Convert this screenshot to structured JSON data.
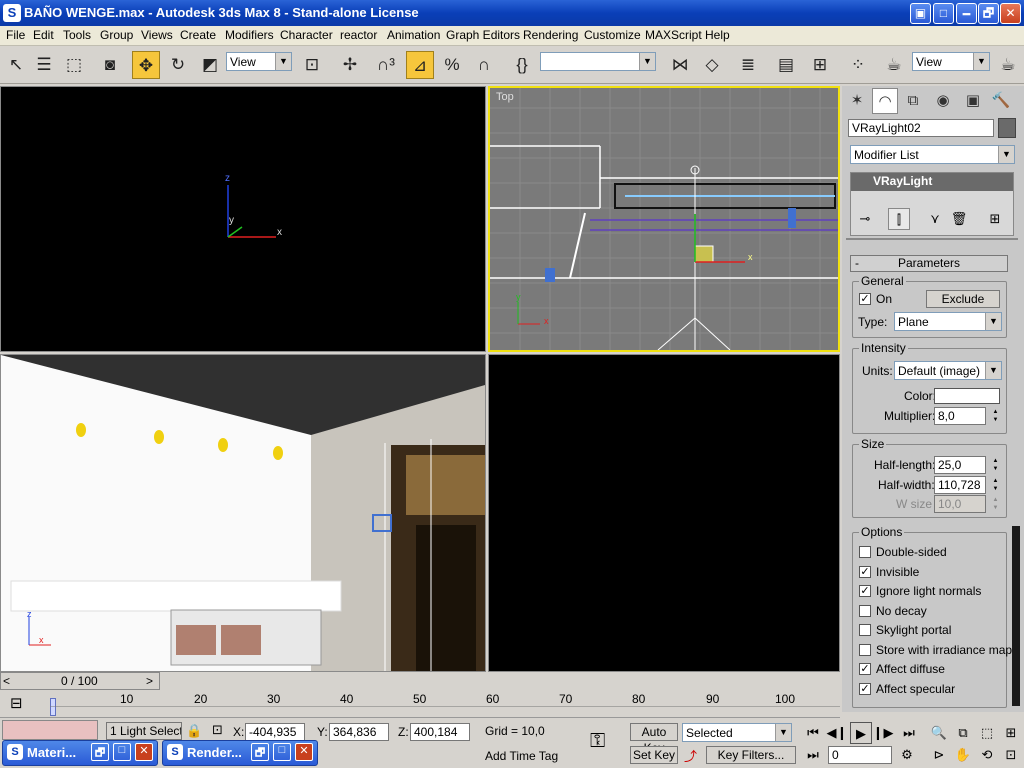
{
  "window": {
    "title": "BAÑO WENGE.max - Autodesk 3ds Max 8  - Stand-alone License",
    "min": "🗕",
    "max": "🗗",
    "close": "✕"
  },
  "menu": [
    "File",
    "Edit",
    "Tools",
    "Group",
    "Views",
    "Create",
    "Modifiers",
    "Character",
    "reactor",
    "Animation",
    "Graph Editors",
    "Rendering",
    "Customize",
    "MAXScript",
    "Help"
  ],
  "toolbar": {
    "ref_coord": "View",
    "named_sel": "",
    "ref_coord2": "View"
  },
  "viewports": {
    "top_label": "Top",
    "axis_x": "x",
    "axis_y": "y",
    "axis_z": "z"
  },
  "panel": {
    "object_name": "VRayLight02",
    "modifier_list": "Modifier List",
    "stack_item": "VRayLight",
    "rollout_title": "Parameters",
    "rollout_sign": "-",
    "general": {
      "title": "General",
      "on_label": "On",
      "on_checked": "✓",
      "exclude": "Exclude",
      "type_label": "Type:",
      "type_value": "Plane"
    },
    "intensity": {
      "title": "Intensity",
      "units_label": "Units:",
      "units_value": "Default (image)",
      "color_label": "Color:",
      "color_value": "#ffffff",
      "multiplier_label": "Multiplier:",
      "multiplier_value": "8,0"
    },
    "size": {
      "title": "Size",
      "half_length_label": "Half-length:",
      "half_length_value": "25,0",
      "half_width_label": "Half-width:",
      "half_width_value": "110,728",
      "w_size_label": "W size",
      "w_size_value": "10,0"
    },
    "options": {
      "title": "Options",
      "items": [
        {
          "label": "Double-sided",
          "mark": ""
        },
        {
          "label": "Invisible",
          "mark": "✓"
        },
        {
          "label": "Ignore light normals",
          "mark": "✓"
        },
        {
          "label": "No decay",
          "mark": ""
        },
        {
          "label": "Skylight portal",
          "mark": ""
        },
        {
          "label": "Store with irradiance map",
          "mark": ""
        },
        {
          "label": "Affect diffuse",
          "mark": "✓"
        },
        {
          "label": "Affect specular",
          "mark": "✓"
        }
      ]
    }
  },
  "timeline": {
    "frame_display": "0 / 100",
    "prev": "<",
    "next": ">",
    "ticks": [
      "10",
      "20",
      "30",
      "40",
      "50",
      "60",
      "70",
      "80",
      "90",
      "100"
    ]
  },
  "status": {
    "selection": "1 Light Select",
    "x_label": "X:",
    "x_value": "-404,935",
    "y_label": "Y:",
    "y_value": "364,836",
    "z_label": "Z:",
    "z_value": "400,184",
    "grid": "Grid = 10,0",
    "add_time_tag": "Add Time Tag",
    "auto_key": "Auto Key",
    "set_key": "Set Key",
    "selected": "Selected",
    "key_filters": "Key Filters...",
    "frame": "0"
  },
  "taskbar": [
    {
      "label": "Materi..."
    },
    {
      "label": "Render..."
    }
  ],
  "colors": {
    "title_blue": "#0a3fb8",
    "viewport_grey": "#7a7a7a",
    "active_border": "#f0e010",
    "toolbar_bg": "#d6d3ce"
  }
}
